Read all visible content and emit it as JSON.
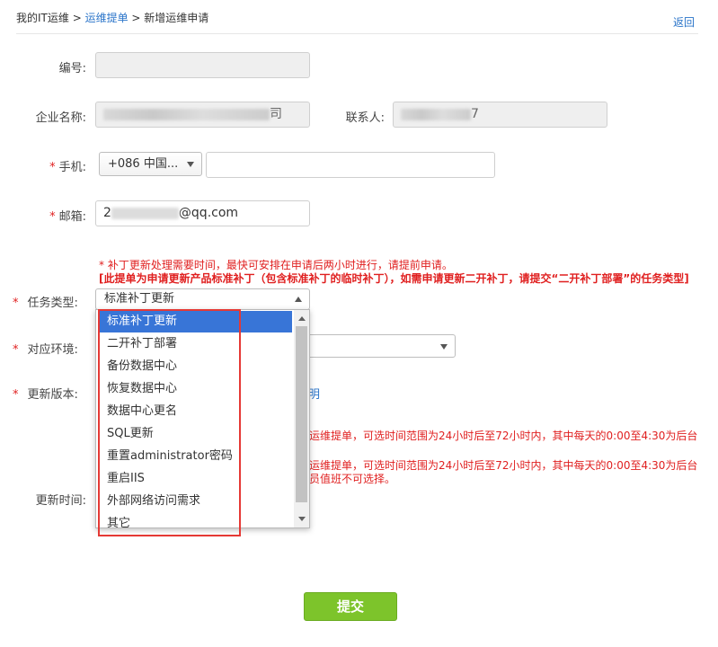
{
  "breadcrumb": {
    "root": "我的IT运维",
    "sep1": " > ",
    "parent": "运维提单",
    "sep2": " > ",
    "current": "新增运维申请"
  },
  "back_label": "返回",
  "form": {
    "number_label": "编号:",
    "number_value": "",
    "company_label": "企业名称:",
    "company_value_suffix": "司",
    "contact_label": "联系人:",
    "contact_value_suffix": "7",
    "phone_label": "手机:",
    "phone_code": "+086 中国...",
    "phone_value": "",
    "email_label": "邮箱:",
    "email_prefix": "2",
    "email_domain": "@qq.com",
    "required_mark": "*",
    "note_1": "* 补丁更新处理需要时间，最快可安排在申请后两小时进行，请提前申请。",
    "note_2": "[此提单为申请更新产品标准补丁（包含标准补丁的临时补丁），如需申请更新二开补丁，请提交“二开补丁部署”的任务类型]",
    "task_type_label": "任务类型:",
    "task_type_value": "标准补丁更新",
    "env_label": "对应环境:",
    "env_value": "",
    "version_label": "更新版本:",
    "version_link_fragment": "明",
    "time_note_1a": "运维提单，可选时间范围为24小时后至72小时内，其中每天的0:00至4:30为后台",
    "time_note_2a": "运维提单，可选时间范围为24小时后至72小时内，其中每天的0:00至4:30为后台",
    "time_note_2b": "员值班不可选择。",
    "update_time_label": "更新时间:"
  },
  "dropdown": {
    "options": [
      "标准补丁更新",
      "二开补丁部署",
      "备份数据中心",
      "恢复数据中心",
      "数据中心更名",
      "SQL更新",
      "重置administrator密码",
      "重启IIS",
      "外部网络访问需求",
      "其它"
    ],
    "selected_index": 0
  },
  "submit_label": "提交",
  "colors": {
    "link": "#2a74c9",
    "required": "#e02020",
    "selected_option": "#3875d7",
    "submit": "#7dc42b",
    "highlight_box": "#e53935"
  }
}
